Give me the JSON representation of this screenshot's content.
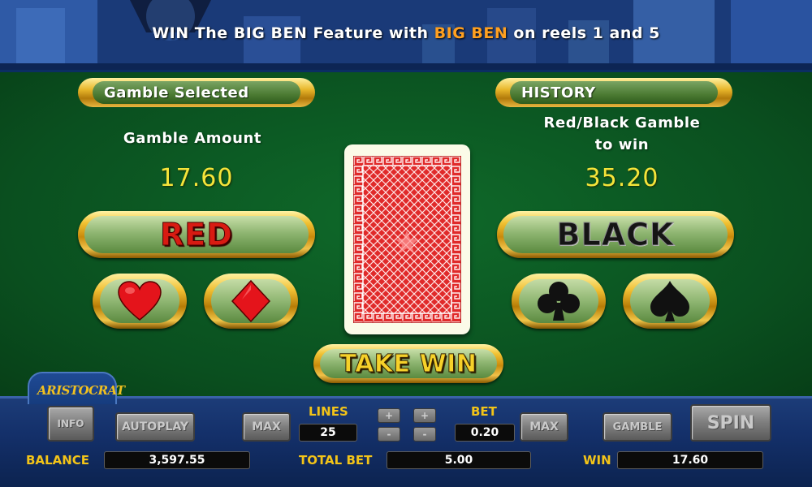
{
  "banner": {
    "part1": "WIN The BIG BEN Feature with ",
    "highlight": "BIG BEN",
    "part2": " on reels 1 and 5"
  },
  "gamble_panel": {
    "header": "Gamble Selected",
    "amount_label": "Gamble Amount",
    "amount_value": "17.60",
    "red_button": "RED",
    "suits_left": [
      "heart-icon",
      "diamond-icon"
    ]
  },
  "history_panel": {
    "header": "HISTORY",
    "label_line1": "Red/Black Gamble",
    "label_line2": "to win",
    "win_value": "35.20",
    "black_button": "BLACK",
    "suits_right": [
      "club-icon",
      "spade-icon"
    ]
  },
  "card": {
    "state": "face-down"
  },
  "take_win_label": "TAKE WIN",
  "controls": {
    "logo": "ARISTOCRAT",
    "info": "INFO",
    "autoplay": "AUTOPLAY",
    "max_lines": "MAX",
    "lines_label": "LINES",
    "lines_value": "25",
    "bet_label": "BET",
    "bet_value": "0.20",
    "max_bet": "MAX",
    "gamble": "GAMBLE",
    "spin": "SPIN",
    "plus": "+",
    "minus": "-"
  },
  "meters": {
    "balance_label": "BALANCE",
    "balance_value": "3,597.55",
    "total_bet_label": "TOTAL BET",
    "total_bet_value": "5.00",
    "win_label": "WIN",
    "win_value": "17.60"
  },
  "colors": {
    "felt": "#0a4f1f",
    "gold": "#f1c233",
    "amount_yellow": "#f5e43a",
    "red": "#d81b12",
    "banner_highlight": "#ffa020"
  }
}
